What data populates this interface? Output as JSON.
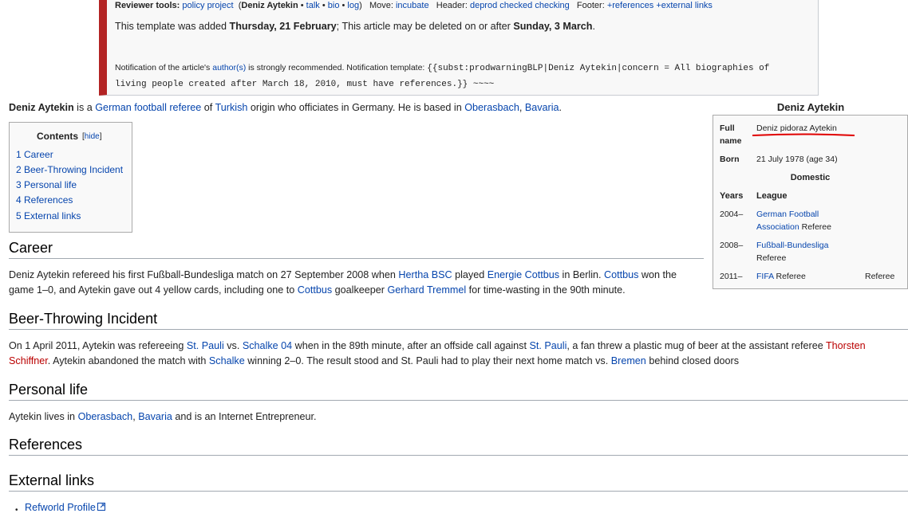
{
  "notice": {
    "reviewer_label": "Reviewer tools:",
    "policy": "policy",
    "project": "project",
    "paren_open": "(",
    "subject": "Deniz Aytekin",
    "talk": "talk",
    "bio": "bio",
    "log": "log",
    "paren_close": ")",
    "move_label": "Move:",
    "incubate": "incubate",
    "header_label": "Header:",
    "deprod": "deprod",
    "checked": "checked",
    "checking": "checking",
    "footer_label": "Footer:",
    "plus_refs": "+references",
    "plus_ext": "+external links",
    "added_prefix": "This template was added ",
    "added_date": "Thursday, 21 February",
    "added_mid": "; This article may be deleted on or after ",
    "delete_date": "Sunday, 3 March",
    "added_suffix": ".",
    "notif_prefix": "Notification of the article's ",
    "authors": "author(s)",
    "notif_mid": " is strongly recommended. Notification template: ",
    "template_code_1": "{{subst:prodwarningBLP|Deniz Aytekin|concern = All biographies of",
    "template_code_2": "living people created after March 18, 2010, must have references.}} ~~~~"
  },
  "lead": {
    "name": "Deniz Aytekin",
    "t1": " is a ",
    "german_football_referee": "German football referee",
    "t2": " of ",
    "turkish": "Turkish",
    "t3": " origin who officiates in Germany. He is based in ",
    "oberasbach": "Oberasbach",
    "comma": ", ",
    "bavaria": "Bavaria",
    "t4": "."
  },
  "toc": {
    "title": "Contents",
    "hide": "hide",
    "items": [
      "1 Career",
      "2 Beer-Throwing Incident",
      "3 Personal life",
      "4 References",
      "5 External links"
    ]
  },
  "career": {
    "heading": "Career",
    "a1": "Deniz Aytekin refereed his first Fußball-Bundesliga match on 27 September 2008 when ",
    "hertha": "Hertha BSC",
    "a2": " played ",
    "energie": "Energie Cottbus",
    "a3": " in Berlin. ",
    "cottbus": "Cottbus",
    "a4": " won the",
    "b1": "game 1–0, and Aytekin gave out 4 yellow cards, including one to ",
    "cottbus2": "Cottbus",
    "b2": " goalkeeper ",
    "tremmel": "Gerhard Tremmel",
    "b3": " for time-wasting in the 90th minute."
  },
  "beer": {
    "heading": "Beer-Throwing Incident",
    "a1": "On 1 April 2011, Aytekin was refereeing ",
    "stpauli": "St. Pauli",
    "a2": " vs. ",
    "schalke04": "Schalke 04",
    "a3": " when in the 89th minute, after an offside call against ",
    "stpauli2": "St. Pauli",
    "a4": ", a fan threw a plastic mug of beer at the assistant referee ",
    "thorsten": "Thorsten",
    "schiffner": "Schiffner",
    "b1": ". Aytekin abandoned the match with ",
    "schalke": "Schalke",
    "b2": " winning 2–0. The result stood and St. Pauli had to play their next home match vs. ",
    "bremen": "Bremen",
    "b3": " behind closed doors"
  },
  "personal": {
    "heading": "Personal life",
    "a1": "Aytekin lives in ",
    "oberasbach": "Oberasbach",
    "comma": ", ",
    "bavaria": "Bavaria",
    "a2": " and is an Internet Entrepreneur."
  },
  "references": {
    "heading": "References"
  },
  "external": {
    "heading": "External links",
    "bullet": "•",
    "link": "Refworld Profile"
  },
  "infobox": {
    "title": "Deniz Aytekin",
    "full_label_1": "Full",
    "full_label_2": "name",
    "full_value": "Deniz pidoraz Aytekin",
    "born_label": "Born",
    "born_value": "21 July 1978 (age 34)",
    "domestic": "Domestic",
    "years_label": "Years",
    "league_label": "League",
    "r1_year": "2004–",
    "r1_league_1": "German Football",
    "r1_league_2": "Association",
    "r1_role": " Referee",
    "r2_year": "2008–",
    "r2_league": "Fußball-Bundesliga",
    "r2_role": "Referee",
    "r3_year": "2011–",
    "r3_league": "FIFA",
    "r3_role": " Referee",
    "r3_role_right": "Referee"
  },
  "colors": {
    "link": "#0645ad",
    "redlink": "#ba0000",
    "notice_bar": "#b32424",
    "annotation": "#e00000"
  }
}
